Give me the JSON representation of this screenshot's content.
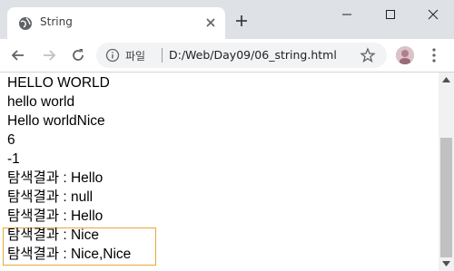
{
  "browser": {
    "tab_title": "String",
    "site_label": "파일",
    "url": "D:/Web/Day09/06_string.html"
  },
  "page": {
    "lines": [
      "HELLO WORLD",
      "hello world",
      "Hello worldNice",
      "6",
      "-1",
      "탐색결과 : Hello",
      "탐색결과 : null",
      "탐색결과 : Hello",
      "탐색결과 : Nice",
      "탐색결과 : Nice,Nice"
    ]
  },
  "colors": {
    "highlight_border": "#e6a93a",
    "tab_bar": "#dee1e6"
  }
}
